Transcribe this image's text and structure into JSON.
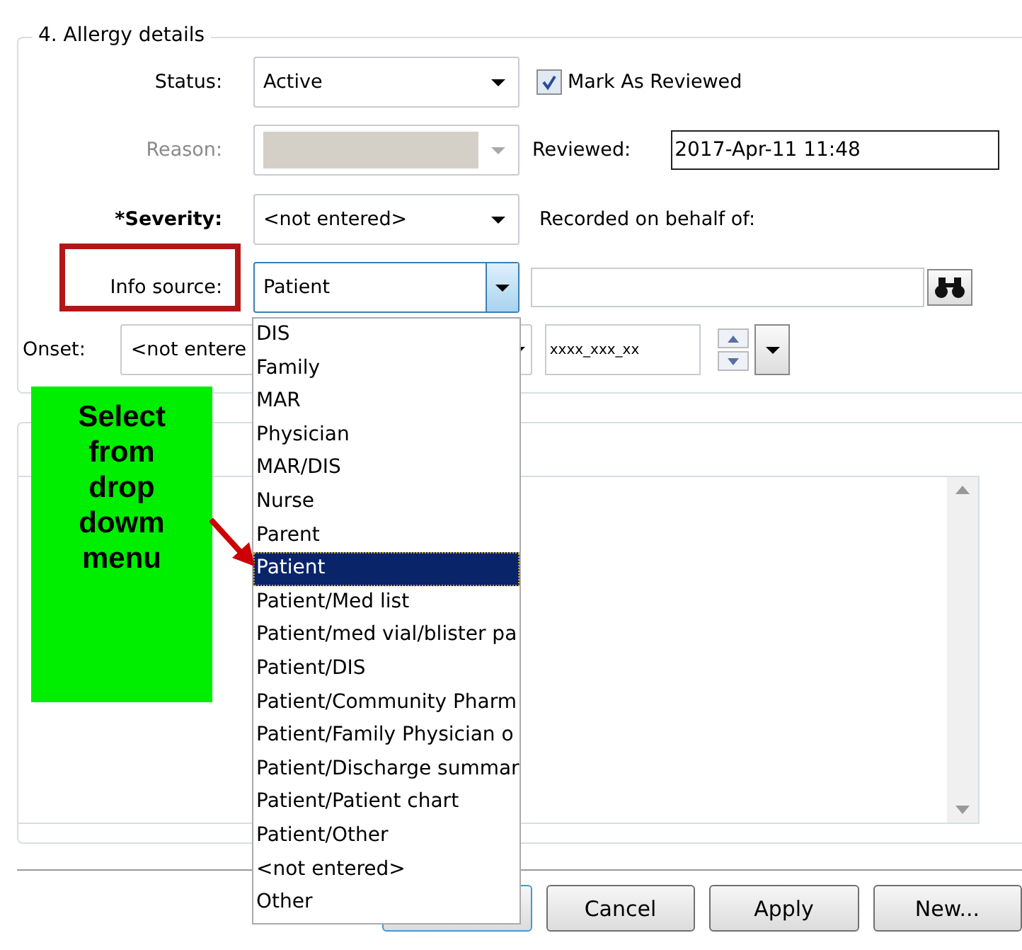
{
  "group": {
    "title": "4. Allergy details"
  },
  "status": {
    "label": "Status:",
    "value": "Active"
  },
  "mark_as_reviewed": {
    "label": "Mark As Reviewed",
    "checked": true
  },
  "reason": {
    "label": "Reason:",
    "disabled": true
  },
  "reviewed": {
    "label": "Reviewed:",
    "value": "2017-Apr-11 11:48"
  },
  "severity": {
    "label": "*Severity:",
    "value": "<not entered>"
  },
  "recorded_on_behalf_of": {
    "label": "Recorded on behalf of:"
  },
  "info_source": {
    "label": "Info source:",
    "value": "Patient",
    "open": true,
    "highlighted": true
  },
  "onset": {
    "label": "Onset:",
    "value": "<not entere",
    "date_mask": "xxxx_xxx_xx"
  },
  "dropdown_options": [
    {
      "label": "DIS",
      "selected": false
    },
    {
      "label": "Family",
      "selected": false
    },
    {
      "label": "MAR",
      "selected": false
    },
    {
      "label": "Physician",
      "selected": false
    },
    {
      "label": "MAR/DIS",
      "selected": false
    },
    {
      "label": "Nurse",
      "selected": false
    },
    {
      "label": "Parent",
      "selected": false
    },
    {
      "label": "Patient",
      "selected": true
    },
    {
      "label": "Patient/Med list",
      "selected": false
    },
    {
      "label": "Patient/med vial/blister pa",
      "selected": false
    },
    {
      "label": "Patient/DIS",
      "selected": false
    },
    {
      "label": "Patient/Community Pharm",
      "selected": false
    },
    {
      "label": "Patient/Family Physician o",
      "selected": false
    },
    {
      "label": "Patient/Discharge summar",
      "selected": false
    },
    {
      "label": "Patient/Patient chart",
      "selected": false
    },
    {
      "label": "Patient/Other",
      "selected": false
    },
    {
      "label": "<not entered>",
      "selected": false
    },
    {
      "label": "Other",
      "selected": false
    }
  ],
  "callout": {
    "text": "Select from drop dowm menu"
  },
  "buttons": [
    "Cancel",
    "Apply",
    "New..."
  ]
}
